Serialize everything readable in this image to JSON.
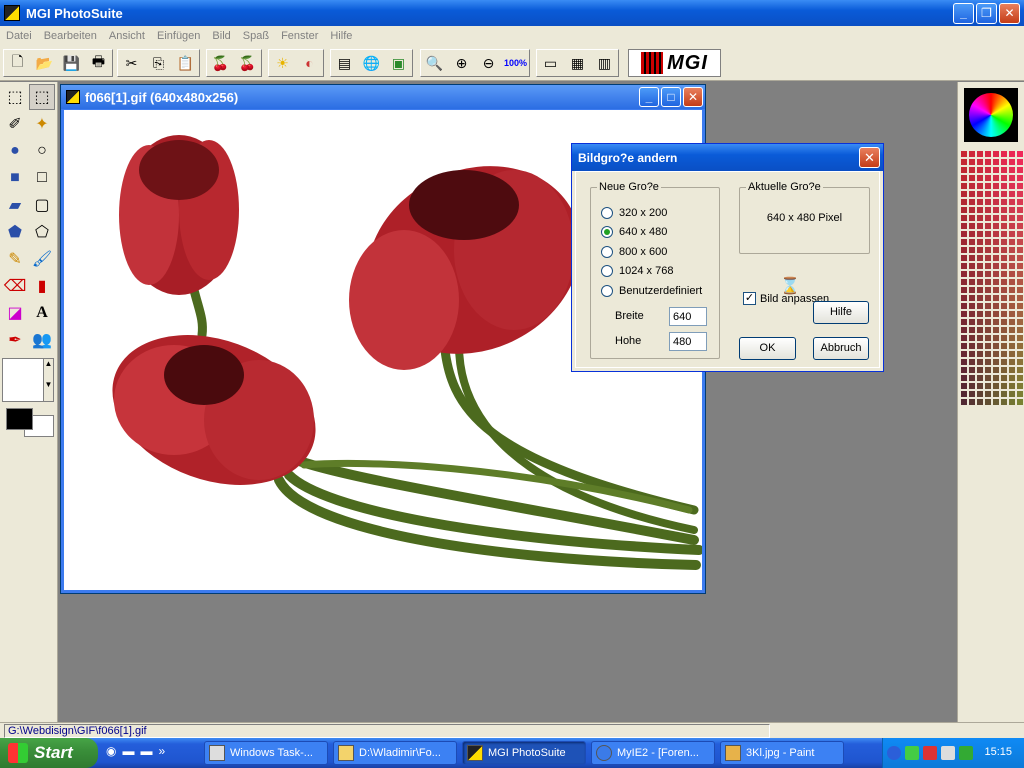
{
  "app": {
    "title": "MGI PhotoSuite",
    "window_buttons": {
      "minimize": "_",
      "maximize": "❐",
      "close": "✕"
    }
  },
  "menu": [
    "Datei",
    "Bearbeiten",
    "Ansicht",
    "Einfügen",
    "Bild",
    "Spaß",
    "Fenster",
    "Hilfe"
  ],
  "toolbar": {
    "zoom_100_label": "100%",
    "logo_text": "MGI"
  },
  "document": {
    "title": "f066[1].gif (640x480x256)"
  },
  "dialog": {
    "title": "Bildgro?e andern",
    "new_size_group": "Neue Gro?e",
    "size_options": [
      {
        "label": "320 x 200",
        "selected": false
      },
      {
        "label": "640 x 480",
        "selected": true
      },
      {
        "label": "800 x 600",
        "selected": false
      },
      {
        "label": "1024 x 768",
        "selected": false
      },
      {
        "label": "Benutzerdefiniert",
        "selected": false
      }
    ],
    "width_label": "Breite",
    "width_value": "640",
    "height_label": "Hohe",
    "height_value": "480",
    "current_size_group": "Aktuelle Gro?e",
    "current_size_value": "640 x 480 Pixel",
    "fit_checkbox_label": "Bild anpassen",
    "fit_checked": true,
    "help_button": "Hilfe",
    "ok_button": "OK",
    "cancel_button": "Abbruch"
  },
  "statusbar": {
    "path": "G:\\Webdisign\\GIF\\f066[1].gif"
  },
  "taskbar": {
    "start_label": "Start",
    "tasks": [
      {
        "label": "Windows Task-...",
        "active": false
      },
      {
        "label": "D:\\Wladimir\\Fo...",
        "active": false
      },
      {
        "label": "MGI PhotoSuite",
        "active": true
      },
      {
        "label": "MyIE2 - [Foren...",
        "active": false
      },
      {
        "label": "3Kl.jpg - Paint",
        "active": false
      }
    ],
    "clock": "15:15"
  },
  "colors": {
    "title_blue": "#0a5bd8",
    "tulip_red": "#b3222a",
    "stem_green": "#4c6a1e"
  }
}
